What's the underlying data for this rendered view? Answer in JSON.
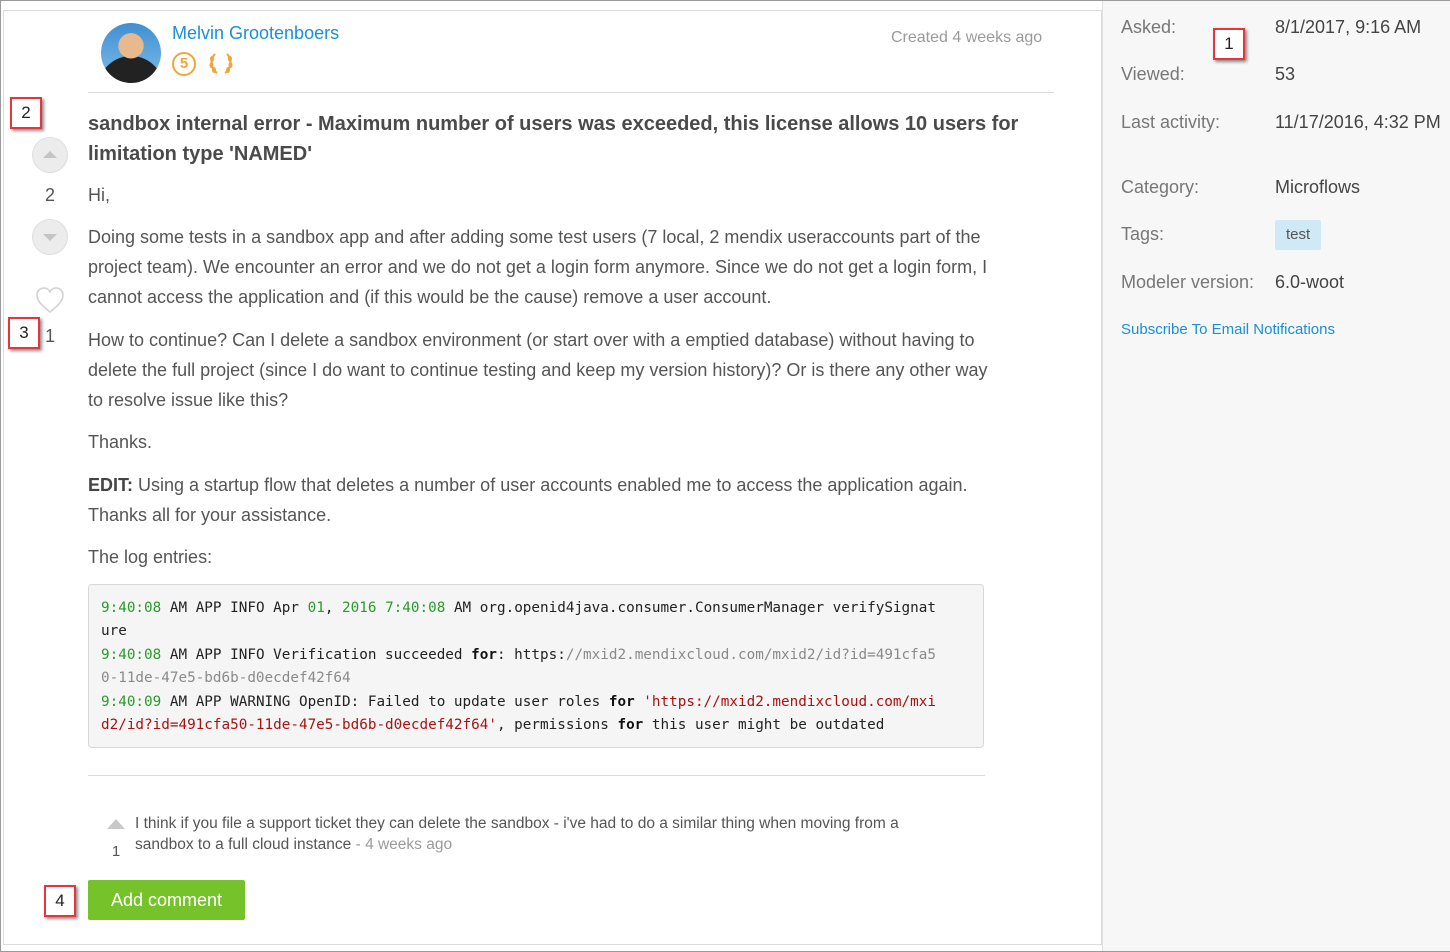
{
  "author": {
    "name": "Melvin Grootenboers",
    "reputation": "5",
    "created": "Created 4 weeks ago"
  },
  "question": {
    "title": "sandbox internal error - Maximum number of users was exceeded, this license allows 10 users for limitation type 'NAMED'",
    "votes": "2",
    "favorites": "1",
    "greeting": "Hi,",
    "paragraph1": "Doing some tests in a sandbox app and after adding some test users (7 local, 2 mendix useraccounts part of the project team). We encounter an error and we do not get a login form anymore. Since we do not get a login form, I cannot access the application and (if this would be the cause) remove a user account.",
    "paragraph2": "How to continue? Can I delete a sandbox environment (or start over with a emptied database) without having to delete the full project (since I do want to continue testing and keep my version history)? Or is there any other way to resolve issue like this?",
    "thanks": "Thanks.",
    "edit_label": "EDIT:",
    "edit_text": " Using a startup flow that deletes a number of user accounts enabled me to access the application again. Thanks all for your assistance.",
    "log_intro": "The log entries:"
  },
  "code": {
    "l1_time": "9:40:08",
    "l1_a": " AM APP INFO Apr ",
    "l1_day": "01",
    "l1_b": ", ",
    "l1_year": "2016",
    "l1_c": " ",
    "l1_time2": "7:40:08",
    "l1_d": " AM org.openid4java.consumer.ConsumerManager verifySignat",
    "l1_wrap": "ure",
    "l2_time": "9:40:08",
    "l2_a": " AM APP INFO Verification succeeded ",
    "l2_kw": "for",
    "l2_b": ": https:",
    "l2_comment": "//mxid2.mendixcloud.com/mxid2/id?id=491cfa5",
    "l2_wrap": "0-11de-47e5-bd6b-d0ecdef42f64",
    "l3_time": "9:40:09",
    "l3_a": " AM APP WARNING OpenID: Failed to update user roles ",
    "l3_kw": "for",
    "l3_b": " ",
    "l3_str": "'https://mxid2.mendixcloud.com/mxi",
    "l3_str_wrap": "d2/id?id=491cfa50-11de-47e5-bd6b-d0ecdef42f64'",
    "l3_c": ", permissions ",
    "l3_kw2": "for",
    "l3_d": " this user might be outdated"
  },
  "comment": {
    "votes": "1",
    "text": "I think if you file a support ticket they can delete the sandbox - i've had to do a similar thing when moving from a sandbox to a full cloud instance",
    "separator": " - ",
    "time": "4 weeks ago"
  },
  "actions": {
    "add_comment": "Add comment"
  },
  "sidebar": {
    "asked_label": "Asked:",
    "asked_value": "8/1/2017, 9:16 AM",
    "viewed_label": "Viewed:",
    "viewed_value": "53",
    "last_activity_label": "Last activity:",
    "last_activity_value": "11/17/2016, 4:32 PM",
    "category_label": "Category:",
    "category_value": "Microflows",
    "tags_label": "Tags:",
    "tag": "test",
    "modeler_label": "Modeler version:",
    "modeler_value": "6.0-woot",
    "subscribe": "Subscribe To Email Notifications"
  },
  "callouts": [
    "1",
    "2",
    "3",
    "4"
  ],
  "colors": {
    "link": "#1a8fd8",
    "button": "#76c22a",
    "badge": "#f0a53b",
    "callout_border": "#e8353b",
    "tag_bg": "#cfe9f7"
  }
}
